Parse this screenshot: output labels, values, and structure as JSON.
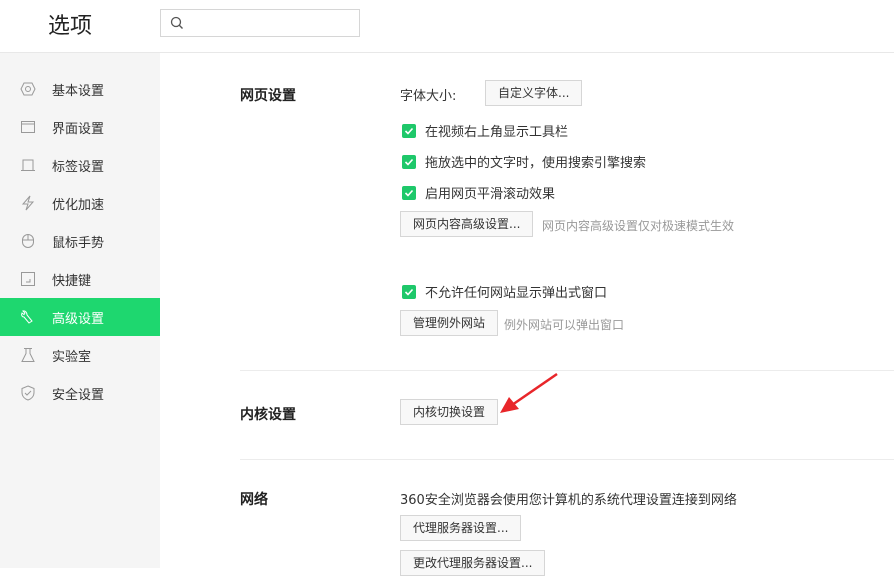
{
  "header": {
    "title": "选项",
    "search_placeholder": ""
  },
  "sidebar": {
    "items": [
      {
        "label": "基本设置",
        "icon": "hexagon-gear-icon"
      },
      {
        "label": "界面设置",
        "icon": "window-icon"
      },
      {
        "label": "标签设置",
        "icon": "tab-icon"
      },
      {
        "label": "优化加速",
        "icon": "lightning-icon"
      },
      {
        "label": "鼠标手势",
        "icon": "mouse-icon"
      },
      {
        "label": "快捷键",
        "icon": "keyboard-icon"
      },
      {
        "label": "高级设置",
        "icon": "wrench-icon",
        "active": true
      },
      {
        "label": "实验室",
        "icon": "flask-icon"
      },
      {
        "label": "安全设置",
        "icon": "shield-icon"
      }
    ]
  },
  "webpage": {
    "title": "网页设置",
    "font_size_label": "字体大小:",
    "custom_font_button": "自定义字体...",
    "checkboxes": [
      "在视频右上角显示工具栏",
      "拖放选中的文字时，使用搜索引擎搜索",
      "启用网页平滑滚动效果"
    ],
    "advanced_button": "网页内容高级设置...",
    "advanced_hint": "网页内容高级设置仅对极速模式生效",
    "popup_checkbox": "不允许任何网站显示弹出式窗口",
    "exceptions_button": "管理例外网站",
    "exceptions_hint": "例外网站可以弹出窗口"
  },
  "kernel": {
    "title": "内核设置",
    "switch_button": "内核切换设置"
  },
  "network": {
    "title": "网络",
    "description": "360安全浏览器会使用您计算机的系统代理设置连接到网络",
    "proxy_button": "代理服务器设置...",
    "change_proxy_button": "更改代理服务器设置..."
  },
  "colors": {
    "accent": "#1ed76f",
    "check": "#1ec86a",
    "arrow": "#e8262a"
  }
}
